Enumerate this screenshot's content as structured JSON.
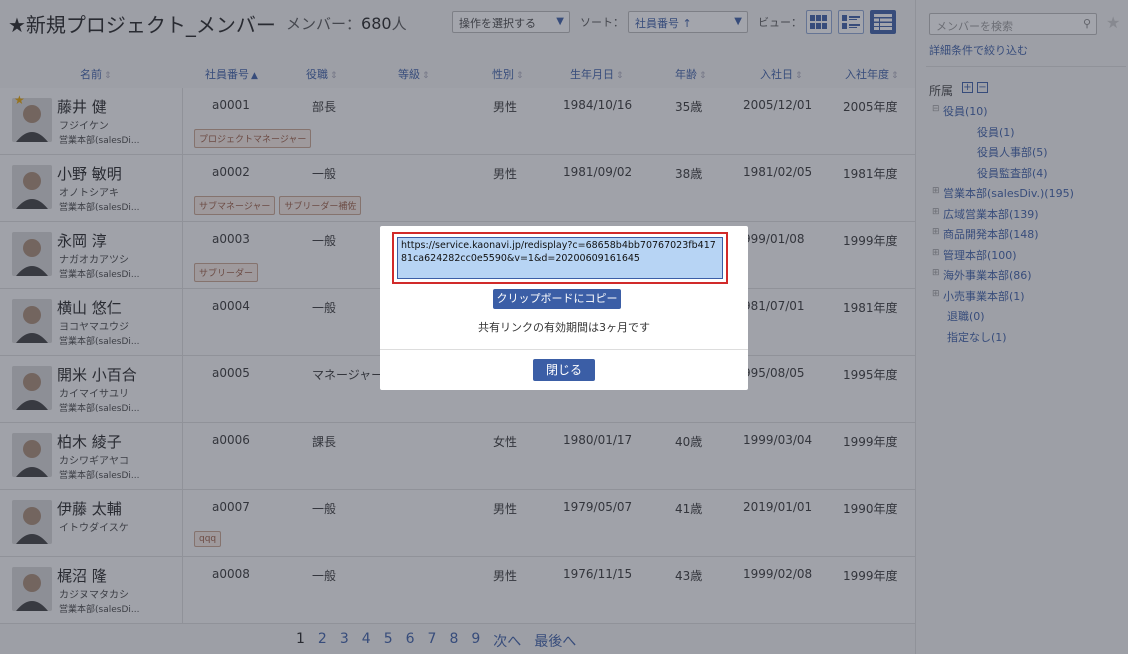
{
  "header": {
    "title": "★新規プロジェクト_メンバー",
    "member_count_label": "メンバー：",
    "member_count": "680",
    "member_count_unit": "人",
    "ops_select": "操作を選択する",
    "sort_label": "ソート：",
    "sort_value": "社員番号 ↑",
    "view_label": "ビュー："
  },
  "columns": [
    "名前",
    "社員番号",
    "役職",
    "等級",
    "性別",
    "生年月日",
    "年齢",
    "入社日",
    "入社年度"
  ],
  "employees": [
    {
      "name": "藤井 健",
      "kana": "フジイケン",
      "dept": "営業本部(salesDi...",
      "id": "a0001",
      "title": "部長",
      "gender": "男性",
      "birth": "1984/10/16",
      "age": "35歳",
      "joined": "2005/12/01",
      "year": "2005年度",
      "tags": [
        "プロジェクトマネージャー"
      ]
    },
    {
      "name": "小野 敏明",
      "kana": "オノトシアキ",
      "dept": "営業本部(salesDi...",
      "id": "a0002",
      "title": "一般",
      "gender": "男性",
      "birth": "1981/09/02",
      "age": "38歳",
      "joined": "1981/02/05",
      "year": "1981年度",
      "tags": [
        "サブマネージャー",
        "サブリーダー補佐"
      ]
    },
    {
      "name": "永岡 淳",
      "kana": "ナガオカアツシ",
      "dept": "営業本部(salesDi...",
      "id": "a0003",
      "title": "一般",
      "gender": "",
      "birth": "",
      "age": "",
      "joined": "999/01/08",
      "year": "1999年度",
      "tags": [
        "サブリーダー"
      ]
    },
    {
      "name": "横山 悠仁",
      "kana": "ヨコヤマユウジ",
      "dept": "営業本部(salesDi...",
      "id": "a0004",
      "title": "一般",
      "gender": "",
      "birth": "",
      "age": "",
      "joined": "981/07/01",
      "year": "1981年度",
      "tags": []
    },
    {
      "name": "開米 小百合",
      "kana": "カイマイサユリ",
      "dept": "営業本部(salesDi...",
      "id": "a0005",
      "title": "マネージャー",
      "gender": "",
      "birth": "",
      "age": "",
      "joined": "995/08/05",
      "year": "1995年度",
      "tags": []
    },
    {
      "name": "柏木 綾子",
      "kana": "カシワギアヤコ",
      "dept": "営業本部(salesDi...",
      "id": "a0006",
      "title": "課長",
      "gender": "女性",
      "birth": "1980/01/17",
      "age": "40歳",
      "joined": "1999/03/04",
      "year": "1999年度",
      "tags": []
    },
    {
      "name": "伊藤 太輔",
      "kana": "イトウダイスケ",
      "dept": "",
      "id": "a0007",
      "title": "一般",
      "gender": "男性",
      "birth": "1979/05/07",
      "age": "41歳",
      "joined": "2019/01/01",
      "year": "1990年度",
      "tags": [
        "qqq"
      ]
    },
    {
      "name": "梶沼 隆",
      "kana": "カジヌマタカシ",
      "dept": "営業本部(salesDi...",
      "id": "a0008",
      "title": "一般",
      "gender": "男性",
      "birth": "1976/11/15",
      "age": "43歳",
      "joined": "1999/02/08",
      "year": "1999年度",
      "tags": []
    }
  ],
  "pagination": {
    "pages": [
      "1",
      "2",
      "3",
      "4",
      "5",
      "6",
      "7",
      "8",
      "9"
    ],
    "next": "次へ",
    "last": "最後へ"
  },
  "sidebar": {
    "search_placeholder": "メンバーを検索",
    "advanced_filter": "詳細条件で絞り込む",
    "affiliation_label": "所属",
    "tree": [
      {
        "label": "役員(10)",
        "level": 0,
        "expander": "⊟"
      },
      {
        "label": "役員(1)",
        "level": 1,
        "expander": ""
      },
      {
        "label": "役員人事部(5)",
        "level": 1,
        "expander": ""
      },
      {
        "label": "役員監査部(4)",
        "level": 1,
        "expander": ""
      },
      {
        "label": "営業本部(salesDiv.)(195)",
        "level": 0,
        "expander": "⊞"
      },
      {
        "label": "広域営業本部(139)",
        "level": 0,
        "expander": "⊞"
      },
      {
        "label": "商品開発本部(148)",
        "level": 0,
        "expander": "⊞"
      },
      {
        "label": "管理本部(100)",
        "level": 0,
        "expander": "⊞"
      },
      {
        "label": "海外事業本部(86)",
        "level": 0,
        "expander": "⊞"
      },
      {
        "label": "小売事業本部(1)",
        "level": 0,
        "expander": "⊞"
      },
      {
        "label": "退職(0)",
        "level": 0,
        "expander": ""
      },
      {
        "label": "指定なし(1)",
        "level": 0,
        "expander": ""
      }
    ]
  },
  "modal": {
    "url": "https://service.kaonavi.jp/redisplay?c=68658b4bb70767023fb41781ca624282cc0e5590&v=1&d=20200609161645",
    "copy_button": "クリップボードにコピー",
    "expiry_note": "共有リンクの有効期間は3ヶ月です",
    "close_button": "閉じる"
  },
  "colors": {
    "accent": "#3b5ea6",
    "highlight_border": "#d12a2a",
    "tag_text": "#9b5c43"
  }
}
